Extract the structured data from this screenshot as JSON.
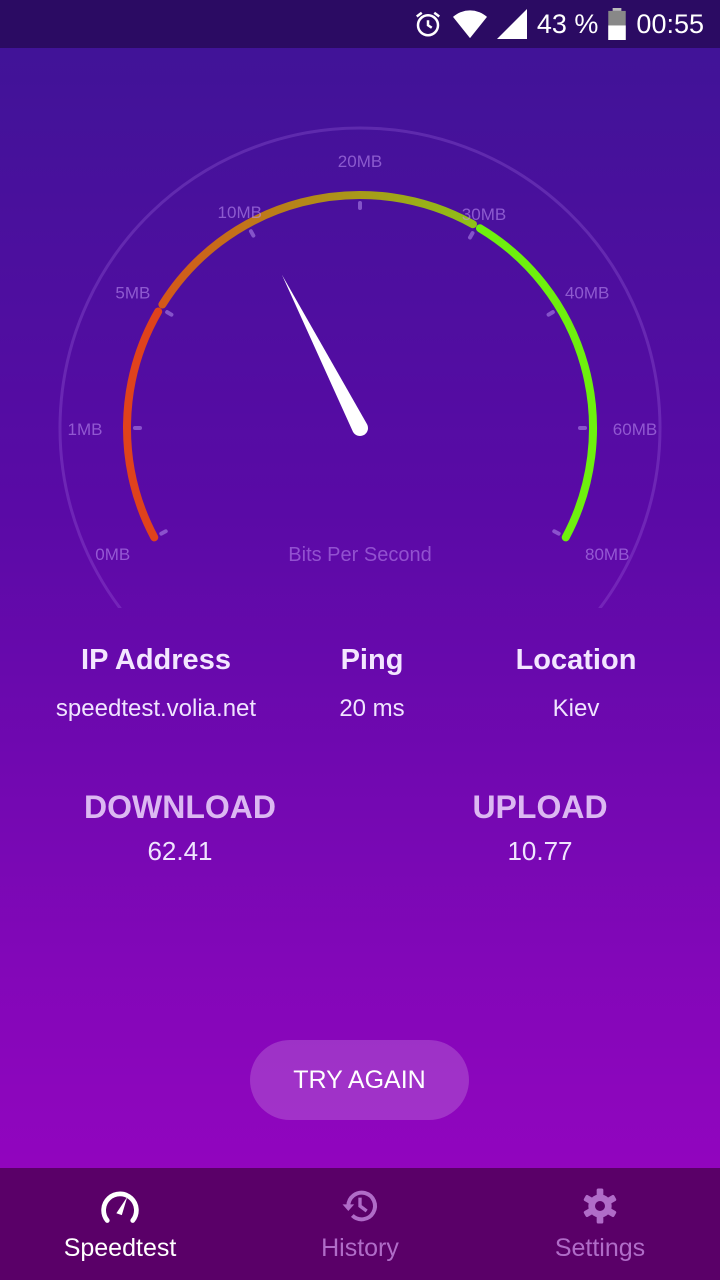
{
  "status_bar": {
    "battery": "43 %",
    "time": "00:55",
    "icons": [
      "alarm-icon",
      "wifi-icon",
      "signal-icon",
      "battery-icon"
    ]
  },
  "gauge": {
    "unit_label": "Bits Per Second",
    "ticks": [
      {
        "label": "0MB",
        "angle": -118
      },
      {
        "label": "1MB",
        "angle": -90
      },
      {
        "label": "5MB",
        "angle": -59
      },
      {
        "label": "10MB",
        "angle": -29
      },
      {
        "label": "20MB",
        "angle": 0
      },
      {
        "label": "30MB",
        "angle": 30
      },
      {
        "label": "40MB",
        "angle": 59
      },
      {
        "label": "60MB",
        "angle": 90
      },
      {
        "label": "80MB",
        "angle": 118
      }
    ],
    "needle_angle": -27,
    "colors": {
      "low": "#e0421c",
      "mid_start": "#d4581a",
      "mid_end": "#8fc018",
      "high": "#6ef00e"
    }
  },
  "info": {
    "ip_label": "IP Address",
    "ip_value": "speedtest.volia.net",
    "ping_label": "Ping",
    "ping_value": "20 ms",
    "location_label": "Location",
    "location_value": "Kiev"
  },
  "results": {
    "download_label": "DOWNLOAD",
    "download_value": "62.41",
    "upload_label": "UPLOAD",
    "upload_value": "10.77"
  },
  "try_again": "TRY AGAIN",
  "nav": [
    {
      "label": "Speedtest",
      "icon": "speedometer-icon",
      "active": true
    },
    {
      "label": "History",
      "icon": "history-icon",
      "active": false
    },
    {
      "label": "Settings",
      "icon": "gear-icon",
      "active": false
    }
  ]
}
